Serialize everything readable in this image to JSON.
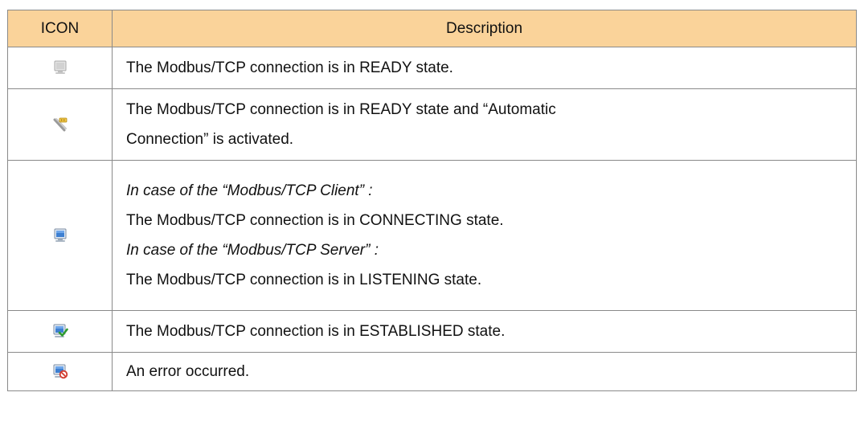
{
  "table": {
    "headers": {
      "icon": "ICON",
      "description": "Description"
    },
    "rows": [
      {
        "icon": "monitor-ready-icon",
        "lines": [
          {
            "text": "The Modbus/TCP connection is in READY state.",
            "italic": false
          }
        ]
      },
      {
        "icon": "monitor-auto-connect-icon",
        "lines": [
          {
            "text": "The Modbus/TCP connection is in READY state and “Automatic",
            "italic": false
          },
          {
            "text": "Connection” is activated.",
            "italic": false
          }
        ]
      },
      {
        "icon": "monitor-connecting-icon",
        "lines": [
          {
            "text": "In case of the “Modbus/TCP Client” :",
            "italic": true
          },
          {
            "text": "The Modbus/TCP connection is in CONNECTING state.",
            "italic": false
          },
          {
            "text": "In case of the “Modbus/TCP Server” :",
            "italic": true
          },
          {
            "text": "The Modbus/TCP connection is in LISTENING state.",
            "italic": false
          }
        ]
      },
      {
        "icon": "monitor-established-icon",
        "lines": [
          {
            "text": "The Modbus/TCP connection is in ESTABLISHED state.",
            "italic": false
          }
        ]
      },
      {
        "icon": "monitor-error-icon",
        "lines": [
          {
            "text": "An error occurred.",
            "italic": false
          }
        ]
      }
    ]
  },
  "colors": {
    "header_bg": "#fad39a",
    "border": "#8a8a8a",
    "check_green": "#2e9b2e",
    "error_red": "#d23a2e"
  }
}
